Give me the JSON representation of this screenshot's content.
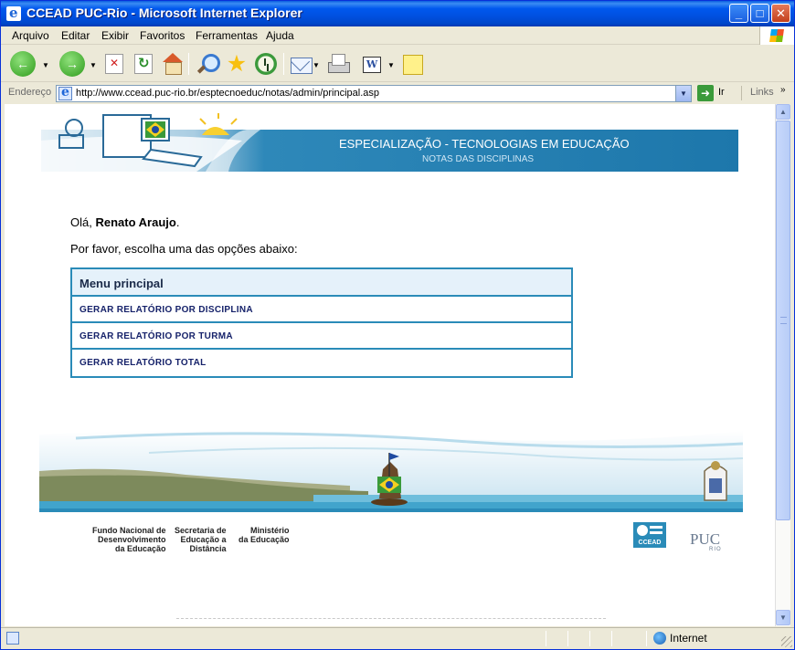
{
  "window": {
    "title": "CCEAD PUC-Rio - Microsoft Internet Explorer",
    "controls": {
      "minimize": "_",
      "maximize": "□",
      "close": "✕"
    }
  },
  "menubar": [
    "Arquivo",
    "Editar",
    "Exibir",
    "Favoritos",
    "Ferramentas",
    "Ajuda"
  ],
  "toolbar": {
    "icons": [
      "back-icon",
      "forward-icon",
      "stop-icon",
      "refresh-icon",
      "home-icon",
      "search-icon",
      "favorites-icon",
      "history-icon",
      "mail-icon",
      "print-icon",
      "edit-icon",
      "discuss-icon"
    ]
  },
  "address": {
    "label": "Endereço",
    "url": "http://www.ccead.puc-rio.br/esptecnoeduc/notas/admin/principal.asp",
    "go_label": "Ir",
    "links_label": "Links"
  },
  "page": {
    "banner_title": "ESPECIALIZAÇÃO - TECNOLOGIAS EM EDUCAÇÃO",
    "banner_subtitle": "NOTAS DAS DISCIPLINAS",
    "greeting_prefix": "Olá, ",
    "user_name": "Renato Araujo",
    "greeting_suffix": ".",
    "instruction": "Por favor, escolha uma das opções abaixo:",
    "menu_header": "Menu principal",
    "menu_items": [
      "GERAR RELATÓRIO POR DISCIPLINA",
      "GERAR RELATÓRIO POR TURMA",
      "GERAR RELATÓRIO TOTAL"
    ],
    "sponsors": [
      {
        "line1": "Fundo Nacional de",
        "line2": "Desenvolvimento",
        "line3": "da Educação"
      },
      {
        "line1": "Secretaria de",
        "line2": "Educação a",
        "line3": "Distância"
      },
      {
        "line1": "Ministério",
        "line2": "da Educação",
        "line3": ""
      }
    ],
    "ccead_logo_text": "CCEAD",
    "puc_text": "PUC",
    "puc_sub": "RIO"
  },
  "status": {
    "zone": "Internet"
  },
  "colors": {
    "accent": "#2a8bb8",
    "banner_dark": "#1f79ad",
    "link_text": "#16226a"
  }
}
